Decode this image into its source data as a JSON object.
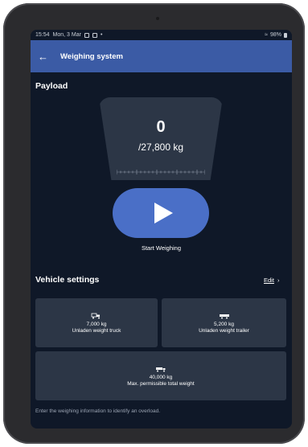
{
  "status_bar": {
    "time": "15:54",
    "date": "Mon, 3 Mar",
    "dot": "•",
    "battery": "98%"
  },
  "app_bar": {
    "title": "Weighing system"
  },
  "payload": {
    "section_title": "Payload",
    "current_value": "0",
    "max_value": "/27,800 kg",
    "start_label": "Start Weighing"
  },
  "vehicle_settings": {
    "section_title": "Vehicle settings",
    "edit_label": "Edit",
    "cards": [
      {
        "icon": "truck-icon",
        "value": "7,000 kg",
        "label": "Unladen weight truck"
      },
      {
        "icon": "trailer-icon",
        "value": "5,200 kg",
        "label": "Unladen weight trailer"
      },
      {
        "icon": "truck-trailer-icon",
        "value": "40,000 kg",
        "label": "Max. permissible total weight"
      }
    ]
  },
  "hint": "Enter the weighing information to identify an overload.",
  "colors": {
    "app_bar": "#3b5ba5",
    "background": "#0f1828",
    "card": "#2c3646",
    "button": "#4a6fc7"
  }
}
